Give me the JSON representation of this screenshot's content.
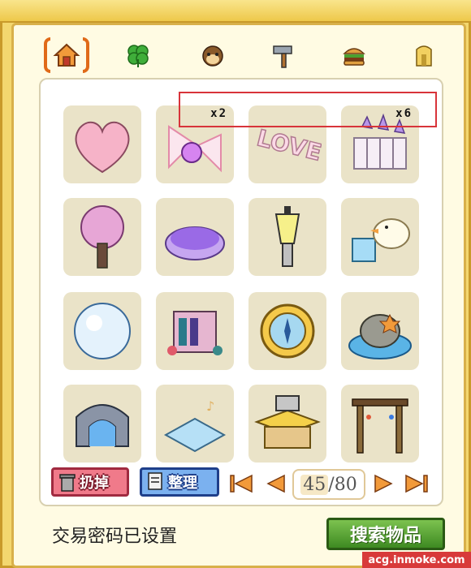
{
  "tabs": [
    {
      "icon": "house-icon",
      "active": true
    },
    {
      "icon": "clover-icon",
      "active": false
    },
    {
      "icon": "pet-face-icon",
      "active": false
    },
    {
      "icon": "hammer-icon",
      "active": false
    },
    {
      "icon": "burger-icon",
      "active": false
    },
    {
      "icon": "building-icon",
      "active": false
    }
  ],
  "items": [
    {
      "name": "pink-heart-tree",
      "qty": ""
    },
    {
      "name": "pink-ribbon-orb",
      "qty": "x2"
    },
    {
      "name": "love-sign",
      "qty": ""
    },
    {
      "name": "crystal-fence",
      "qty": "x6"
    },
    {
      "name": "sakura-tree",
      "qty": ""
    },
    {
      "name": "purple-cushion",
      "qty": ""
    },
    {
      "name": "street-lamp",
      "qty": ""
    },
    {
      "name": "duck-and-box",
      "qty": ""
    },
    {
      "name": "snow-globe",
      "qty": ""
    },
    {
      "name": "flower-bookshelf",
      "qty": ""
    },
    {
      "name": "golden-compass",
      "qty": ""
    },
    {
      "name": "rock-pond",
      "qty": ""
    },
    {
      "name": "stone-pool",
      "qty": ""
    },
    {
      "name": "music-floor-mat",
      "qty": ""
    },
    {
      "name": "yellow-stall",
      "qty": ""
    },
    {
      "name": "wooden-arch",
      "qty": ""
    }
  ],
  "toolbar": {
    "discard_label": "扔掉",
    "sort_label": "整理",
    "page_current": "45",
    "page_total": "/80"
  },
  "status_text": "交易密码已设置",
  "search_label": "搜索物品",
  "watermark": "acg.inmoke.com"
}
